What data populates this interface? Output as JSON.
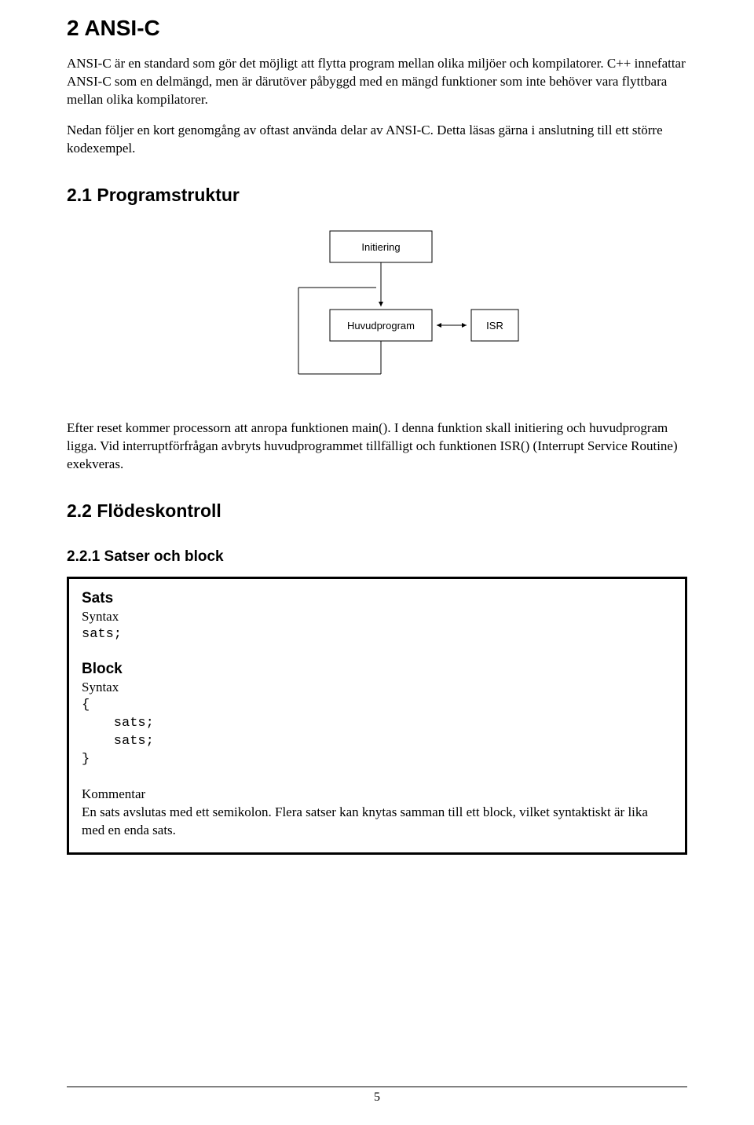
{
  "h1": "2  ANSI-C",
  "p1": "ANSI-C är en standard som gör det möjligt att flytta program mellan olika miljöer och kompilatorer. C++ innefattar ANSI-C som en delmängd, men är därutöver påbyggd med en mängd funktioner som inte behöver vara flyttbara mellan olika kompilatorer.",
  "p2": "Nedan följer en kort genomgång av oftast använda delar av ANSI-C. Detta läsas gärna i anslutning till ett större kodexempel.",
  "h2_1": "2.1 Programstruktur",
  "diagram": {
    "initiering": "Initiering",
    "huvudprogram": "Huvudprogram",
    "isr": "ISR"
  },
  "p3": "Efter reset kommer processorn att anropa funktionen main(). I denna funktion skall initiering och huvudprogram ligga. Vid interruptförfrågan avbryts huvudprogrammet tillfälligt och funktionen ISR() (Interrupt Service Routine) exekveras.",
  "h2_2": "2.2 Flödeskontroll",
  "h3_1": "2.2.1 Satser och block",
  "box": {
    "sats_heading": "Sats",
    "syntax_label1": "Syntax",
    "sats_code": "sats;",
    "block_heading": "Block",
    "syntax_label2": "Syntax",
    "block_code": "{\n    sats;\n    sats;\n}",
    "kommentar_label": "Kommentar",
    "kommentar_text": "En sats avslutas med ett semikolon. Flera satser kan knytas samman till ett block, vilket syntaktiskt är lika med en enda sats."
  },
  "page_number": "5"
}
